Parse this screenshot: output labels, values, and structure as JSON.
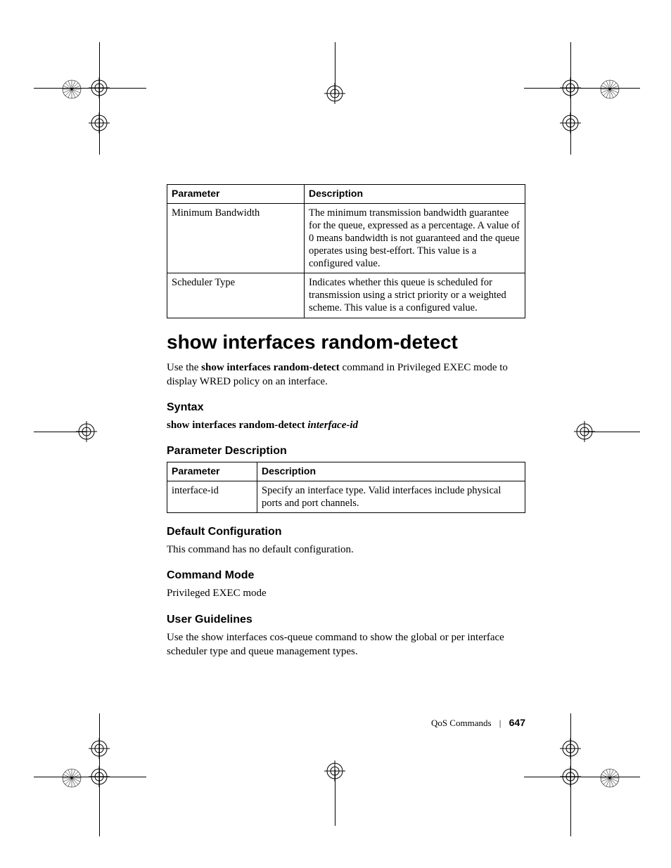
{
  "table1": {
    "headers": {
      "param": "Parameter",
      "desc": "Description"
    },
    "rows": [
      {
        "param": "Minimum Bandwidth",
        "desc": "The minimum transmission bandwidth guarantee for the queue, expressed as a percentage. A value of 0 means bandwidth is not guaranteed and the queue operates using best-effort. This value is a configured value."
      },
      {
        "param": "Scheduler Type",
        "desc": "Indicates whether this queue is scheduled for transmission using a strict priority or a weighted scheme. This value is a configured value."
      }
    ]
  },
  "heading": "show interfaces random-detect",
  "intro": {
    "pre": "Use the ",
    "cmd": "show interfaces random-detect",
    "post": " command in Privileged EXEC mode to display WRED policy on an interface."
  },
  "syntax": {
    "title": "Syntax",
    "cmd": "show interfaces random-detect ",
    "arg": "interface-id"
  },
  "paramDesc": {
    "title": "Parameter Description"
  },
  "table2": {
    "headers": {
      "param": "Parameter",
      "desc": "Description"
    },
    "rows": [
      {
        "param": "interface-id",
        "desc": "Specify an interface type. Valid interfaces include physical ports and port channels."
      }
    ]
  },
  "defaultCfg": {
    "title": "Default Configuration",
    "body": "This command has no default configuration."
  },
  "cmdMode": {
    "title": "Command Mode",
    "body": "Privileged EXEC mode"
  },
  "guidelines": {
    "title": "User Guidelines",
    "body": "Use the show interfaces cos-queue command to show the global or per interface scheduler type and queue management types."
  },
  "footer": {
    "chapter": "QoS Commands",
    "page": "647"
  }
}
